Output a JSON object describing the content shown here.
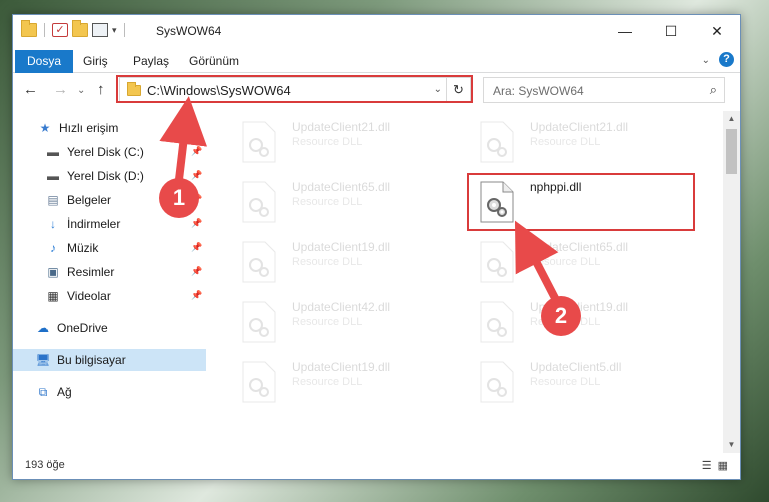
{
  "window": {
    "title": "SysWOW64",
    "controls": {
      "minimize": "—",
      "maximize": "☐",
      "close": "✕"
    }
  },
  "ribbon": {
    "tabs": [
      "Dosya",
      "Giriş",
      "Paylaş",
      "Görünüm"
    ],
    "help": "?"
  },
  "address_bar": {
    "path": "C:\\Windows\\SysWOW64",
    "search_placeholder": "Ara: SysWOW64"
  },
  "nav_pane": {
    "quick_access": "Hızlı erişim",
    "quick_items": [
      {
        "label": "Yerel Disk (C:)",
        "icon": "drive-icon"
      },
      {
        "label": "Yerel Disk (D:)",
        "icon": "drive-icon"
      },
      {
        "label": "Belgeler",
        "icon": "documents-icon"
      },
      {
        "label": "İndirmeler",
        "icon": "download-icon"
      },
      {
        "label": "Müzik",
        "icon": "music-icon"
      },
      {
        "label": "Resimler",
        "icon": "pictures-icon"
      },
      {
        "label": "Videolar",
        "icon": "video-icon"
      }
    ],
    "onedrive": "OneDrive",
    "this_pc": "Bu bilgisayar",
    "network": "Ağ"
  },
  "files": {
    "left_column": [
      {
        "name": "UpdateClient21.dll",
        "desc": "Resource DLL"
      },
      {
        "name": "UpdateClient65.dll",
        "desc": "Resource DLL"
      },
      {
        "name": "UpdateClient19.dll",
        "desc": "Resource DLL"
      },
      {
        "name": "UpdateClient42.dll",
        "desc": "Resource DLL"
      },
      {
        "name": "UpdateClient19.dll",
        "desc": "Resource DLL"
      }
    ],
    "right_column": [
      {
        "name": "UpdateClient21.dll",
        "desc": "Resource DLL"
      },
      {
        "name": "nphppi.dll",
        "desc": ""
      },
      {
        "name": "UpdateClient65.dll",
        "desc": "Resource DLL"
      },
      {
        "name": "UpdateClient19.dll",
        "desc": "Resource DLL"
      },
      {
        "name": "UpdateClient5.dll",
        "desc": "Resource DLL"
      }
    ]
  },
  "status_bar": {
    "count": "193 öğe"
  },
  "annotations": {
    "step1": "1",
    "step2": "2"
  },
  "colors": {
    "accent": "#1979ca",
    "highlight": "#d93b3b",
    "badge": "#e84a4a",
    "selected": "#cce4f7"
  }
}
